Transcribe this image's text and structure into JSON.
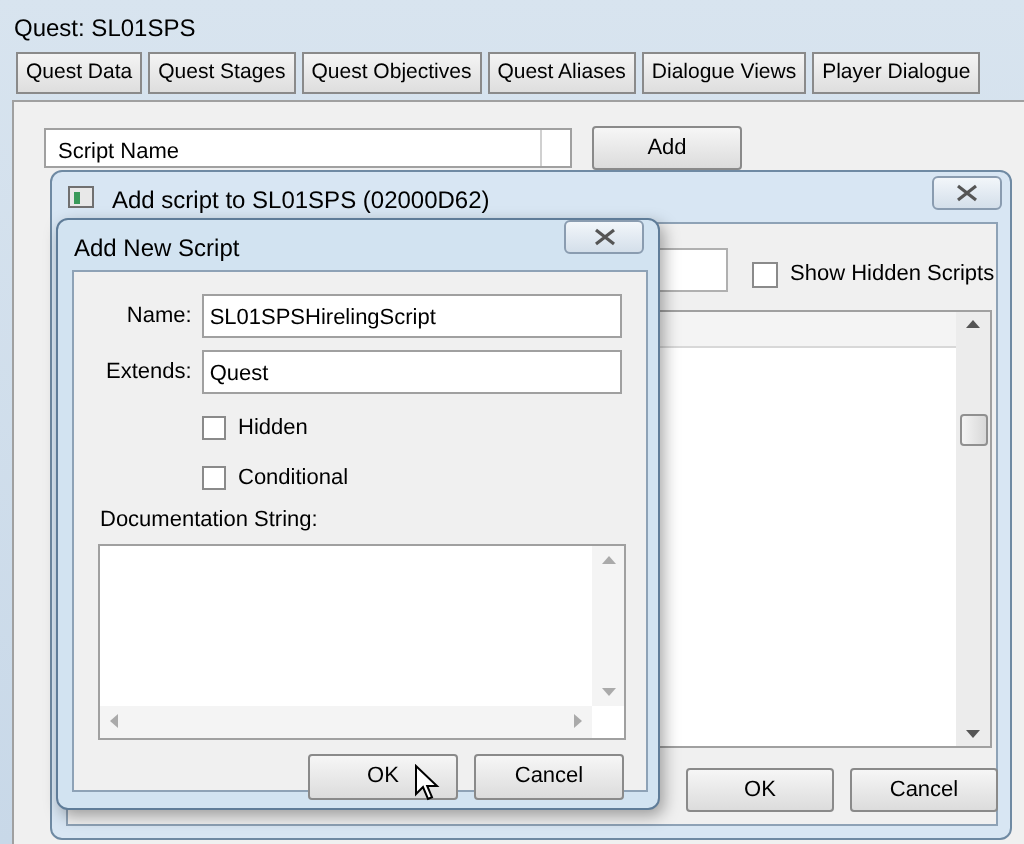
{
  "quest_window": {
    "title": "Quest: SL01SPS",
    "tabs": [
      {
        "label": "Quest Data",
        "selected": false
      },
      {
        "label": "Quest Stages",
        "selected": false
      },
      {
        "label": "Quest Objectives",
        "selected": false
      },
      {
        "label": "Quest Aliases",
        "selected": false
      },
      {
        "label": "Dialogue Views",
        "selected": false
      },
      {
        "label": "Player Dialogue",
        "selected": false
      }
    ],
    "script_column": "Script Name",
    "add_button": "Add"
  },
  "add_script_window": {
    "title": "Add script to SL01SPS (02000D62)",
    "show_hidden": {
      "label": "Show Hidden Scripts",
      "checked": false
    },
    "buttons": [
      "OK",
      "Cancel"
    ]
  },
  "new_script_dialog": {
    "title": "Add New Script",
    "fields": [
      {
        "label": "Name:",
        "value": "SL01SPSHirelingScript"
      },
      {
        "label": "Extends:",
        "value": "Quest"
      }
    ],
    "options": [
      {
        "label": "Hidden",
        "checked": false
      },
      {
        "label": "Conditional",
        "checked": false
      }
    ],
    "documentation_label": "Documentation String:",
    "buttons": [
      "OK",
      "Cancel"
    ]
  }
}
